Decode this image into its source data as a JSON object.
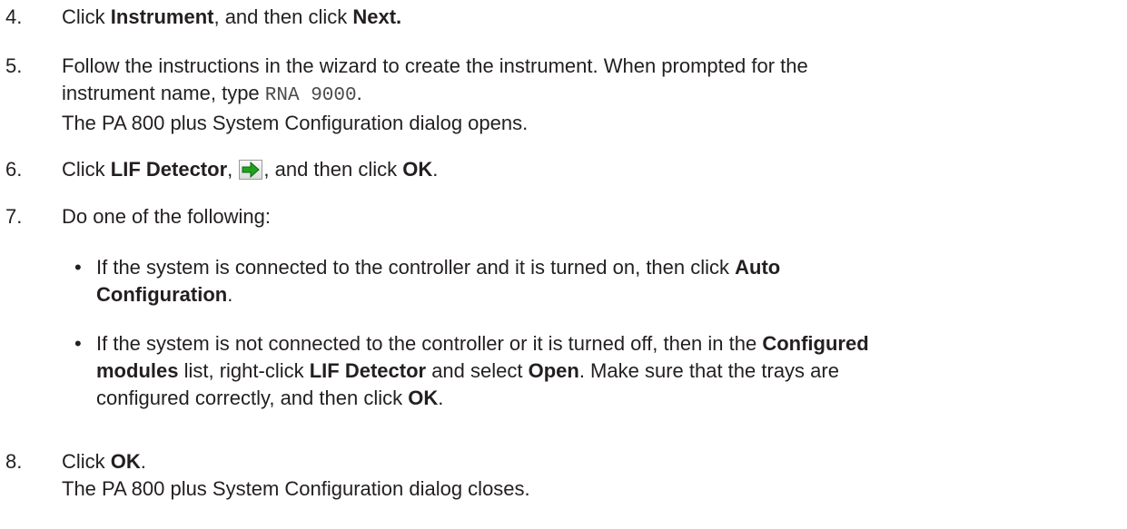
{
  "steps": [
    {
      "num": "4.",
      "t1": "Click ",
      "b1": "Instrument",
      "t2": ", and then click ",
      "b2": "Next."
    },
    {
      "num": "5.",
      "line1": "Follow the instructions in the wizard to create the instrument. When prompted for the",
      "line2_pre": "instrument name, type ",
      "code": "RNA 9000",
      "line2_post": ".",
      "line3": "The PA 800 plus System Configuration dialog opens."
    },
    {
      "num": "6.",
      "t1": "Click ",
      "b1": "LIF Detector",
      "t2": ", ",
      "t3": ", and then click ",
      "b2": "OK",
      "t4": "."
    },
    {
      "num": "7.",
      "t1": "Do one of the following:"
    },
    {
      "num": "8.",
      "t1": "Click ",
      "b1": "OK",
      "t2": ".",
      "line2": "The PA 800 plus System Configuration dialog closes."
    }
  ],
  "bullets": [
    {
      "dot": "•",
      "t1": "If the system is connected to the controller and it is turned on, then click ",
      "b1": "Auto",
      "b2": "Configuration",
      "t2": "."
    },
    {
      "dot": "•",
      "t1": "If the system is not connected to the controller or it is turned off, then in the ",
      "b1": "Configured",
      "b2": "modules",
      "t2": " list, right-click ",
      "b3": "LIF Detector",
      "t3": " and select ",
      "b4": "Open",
      "t4": ". Make sure that the trays are",
      "t5": "configured correctly, and then click ",
      "b5": "OK",
      "t6": "."
    }
  ],
  "icons": {
    "next_arrow": "green-right-arrow-icon"
  },
  "colors": {
    "arrow_green": "#1fa21f",
    "text": "#231f20"
  }
}
